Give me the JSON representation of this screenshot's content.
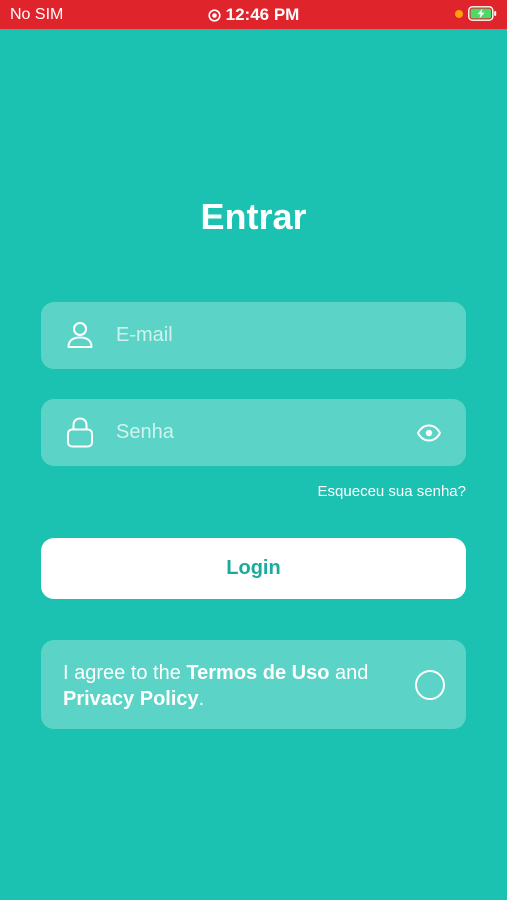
{
  "status_bar": {
    "carrier": "No SIM",
    "time": "12:46 PM"
  },
  "login": {
    "title": "Entrar",
    "email_placeholder": "E-mail",
    "password_placeholder": "Senha",
    "forgot_password": "Esqueceu sua senha?",
    "login_button": "Login"
  },
  "agreement": {
    "prefix": "I agree to the ",
    "terms_link": "Termos de Uso",
    "middle": " and ",
    "privacy_link": "Privacy Policy",
    "suffix": "."
  },
  "colors": {
    "background": "#1cc2b1",
    "status_bar": "#e0242b",
    "login_text": "#1aab9c"
  },
  "icons": {
    "email": "user-icon",
    "password": "lock-icon",
    "visibility": "eye-icon",
    "agree": "radio-circle-icon"
  }
}
